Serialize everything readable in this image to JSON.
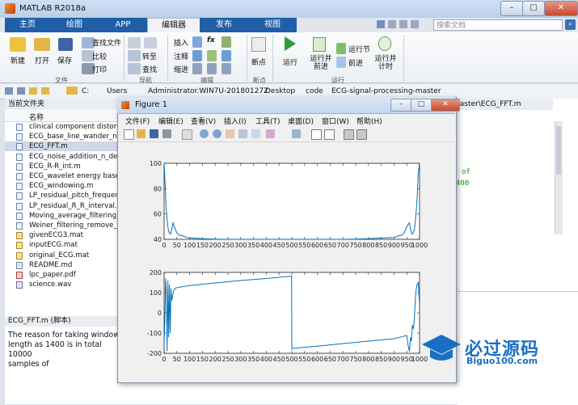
{
  "window": {
    "title": "MATLAB R2018a",
    "min": "–",
    "max": "□",
    "close": "✕"
  },
  "tabs": [
    "主页",
    "绘图",
    "APP",
    "编辑器",
    "发布",
    "视图"
  ],
  "search_placeholder": "搜索文档",
  "ribbon": {
    "new": "新建",
    "open": "打开",
    "save": "保存",
    "find_files": "查找文件",
    "compare": "比较",
    "print": "打印",
    "goto": "转至",
    "find": "查找",
    "insert": "插入",
    "comment": "注释",
    "indent": "缩进",
    "fx": "fx",
    "breakpoints": "断点",
    "run": "运行",
    "run_advance": "运行并\n前进",
    "run_section": "运行节",
    "advance": "前进",
    "run_time": "运行并\n计时",
    "groups": [
      "文件",
      "导航",
      "编辑",
      "断点",
      "运行"
    ]
  },
  "address": [
    "C:",
    "Users",
    "Administrator.WIN7U-20180127Z",
    "Desktop",
    "code",
    "ECG-signal-processing-master"
  ],
  "left_panel": {
    "title": "当前文件夹",
    "col": "名称",
    "files": [
      {
        "name": "clinical component distort",
        "kind": "m"
      },
      {
        "name": "ECG_base_line_wander_no",
        "kind": "m"
      },
      {
        "name": "ECG_FFT.m",
        "kind": "m",
        "selected": true
      },
      {
        "name": "ECG_noise_addition_n_der",
        "kind": "m"
      },
      {
        "name": "ECG_R-R_int.m",
        "kind": "m"
      },
      {
        "name": "ECG_wavelet energy base",
        "kind": "m"
      },
      {
        "name": "ECG_windowing.m",
        "kind": "m"
      },
      {
        "name": "LP_residual_pitch_frequenc",
        "kind": "m"
      },
      {
        "name": "LP_residual_R_R_interval.m",
        "kind": "m"
      },
      {
        "name": "Moving_average_filtering_",
        "kind": "m"
      },
      {
        "name": "Weiner_filtering_remove_",
        "kind": "m"
      },
      {
        "name": "givenECG3.mat",
        "kind": "mat"
      },
      {
        "name": "inputECG.mat",
        "kind": "mat"
      },
      {
        "name": "original_ECG.mat",
        "kind": "mat"
      },
      {
        "name": "README.md",
        "kind": "md"
      },
      {
        "name": "lpc_paper.pdf",
        "kind": "pdf"
      },
      {
        "name": "science.wav",
        "kind": "wav"
      }
    ],
    "detail_title": "ECG_FFT.m  (脚本)",
    "detail_text": [
      "The reason for taking window",
      "length as 1400 is in total 10000",
      "samples of"
    ]
  },
  "editor": {
    "path": "master\\ECG_FFT.m",
    "code": [
      "of",
      "400"
    ]
  },
  "figure": {
    "title": "Figure 1",
    "menus": [
      "文件(F)",
      "编辑(E)",
      "查看(V)",
      "插入(I)",
      "工具(T)",
      "桌面(D)",
      "窗口(W)",
      "帮助(H)"
    ],
    "min": "–",
    "max": "□",
    "close": "✕"
  },
  "chart_data": [
    {
      "type": "line",
      "xlim": [
        0,
        1000
      ],
      "ylim": [
        40,
        100
      ],
      "xticks": [
        0,
        50,
        100,
        150,
        200,
        250,
        300,
        350,
        400,
        450,
        500,
        550,
        600,
        650,
        700,
        750,
        800,
        850,
        900,
        950,
        1000
      ],
      "yticks": [
        40,
        60,
        80,
        100
      ],
      "series": [
        {
          "color": "#0072bd",
          "x": [
            0,
            2,
            5,
            8,
            12,
            16,
            20,
            25,
            30,
            35,
            40,
            50,
            60,
            70,
            80,
            90,
            100,
            150,
            200,
            250,
            300,
            350,
            400,
            450,
            500,
            550,
            600,
            650,
            700,
            750,
            800,
            850,
            900,
            910,
            920,
            930,
            940,
            950,
            960,
            965,
            970,
            975,
            980,
            984,
            988,
            992,
            995,
            998,
            1000
          ],
          "y": [
            100,
            93,
            78,
            65,
            55,
            48,
            45,
            44,
            48,
            53,
            50,
            45,
            43,
            43,
            42,
            41.5,
            41,
            40.5,
            40.2,
            40,
            40,
            40,
            40,
            40,
            40,
            40,
            40,
            40,
            40,
            40.2,
            40.5,
            41,
            41.5,
            42,
            43,
            43,
            45,
            50,
            53,
            48,
            44,
            45,
            48,
            55,
            65,
            78,
            93,
            97,
            100
          ]
        }
      ]
    },
    {
      "type": "line",
      "xlim": [
        0,
        1000
      ],
      "ylim": [
        -200,
        200
      ],
      "xticks": [
        0,
        50,
        100,
        150,
        200,
        250,
        300,
        350,
        400,
        450,
        500,
        550,
        600,
        650,
        700,
        750,
        800,
        850,
        900,
        950,
        1000
      ],
      "yticks": [
        -200,
        -100,
        0,
        100,
        200
      ],
      "series": [
        {
          "color": "#0072bd",
          "x": [
            0,
            3,
            6,
            9,
            12,
            15,
            18,
            21,
            24,
            27,
            30,
            34,
            38,
            42,
            50,
            100,
            200,
            300,
            400,
            499,
            500,
            501,
            600,
            700,
            800,
            900,
            940,
            950,
            955,
            960,
            965,
            968,
            972,
            976,
            980,
            985,
            990,
            995,
            1000
          ],
          "y": [
            -150,
            -40,
            170,
            100,
            -190,
            160,
            -120,
            140,
            -100,
            120,
            60,
            90,
            110,
            120,
            125,
            135,
            148,
            160,
            170,
            182,
            -178,
            -176,
            -165,
            -152,
            -140,
            -128,
            -115,
            -112,
            -160,
            -190,
            -120,
            -140,
            -60,
            -80,
            -20,
            100,
            140,
            150,
            40
          ]
        }
      ]
    }
  ],
  "watermark": {
    "text": "必过源码",
    "sub": "Biguo100.com"
  },
  "colors": {
    "tab_blue": "#1f5fa8",
    "line": "#0072bd",
    "watermark": "#1a6fc4"
  }
}
